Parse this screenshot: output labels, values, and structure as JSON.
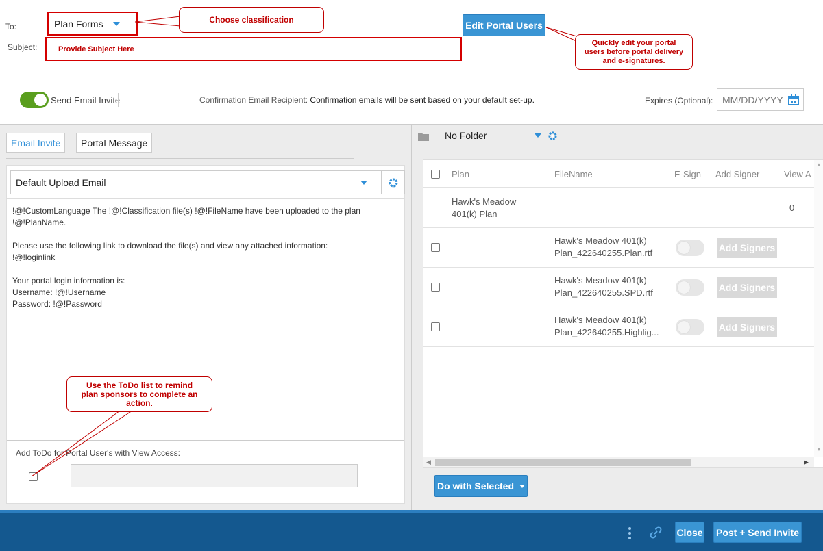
{
  "header": {
    "to_label": "To:",
    "classification_value": "Plan Forms",
    "subject_label": "Subject:",
    "subject_value": "Provide Subject Here",
    "edit_portal_users_label": "Edit Portal Users"
  },
  "callouts": {
    "classification": "Choose classification",
    "edit_users": "Quickly edit your portal users before portal delivery and e-signatures.",
    "todo": "Use the ToDo list to remind plan sponsors to complete an action."
  },
  "options_bar": {
    "send_email_invite_label": "Send Email Invite",
    "send_email_invite_on": true,
    "confirmation_label": "Confirmation Email Recipient:",
    "confirmation_text": "Confirmation emails will be sent based on your default set-up.",
    "expires_label": "Expires (Optional):",
    "expires_placeholder": "MM/DD/YYYY"
  },
  "left": {
    "tabs": [
      {
        "label": "Email Invite",
        "active": true
      },
      {
        "label": "Portal Message",
        "active": false
      }
    ],
    "template_select": "Default Upload Email",
    "email_body": "!@!CustomLanguage The !@!Classification file(s) !@!FileName have been uploaded to the plan\n!@!PlanName.\n\nPlease use the following link to download the file(s) and view any attached information:\n!@!loginlink\n\nYour portal login information is:\nUsername: !@!Username\nPassword: !@!Password",
    "todo_label": "Add ToDo for Portal User's with View Access:",
    "todo_value": ""
  },
  "right": {
    "folder": "No Folder",
    "columns": [
      "Plan",
      "FileName",
      "E-Sign",
      "Add Signer",
      "View A"
    ],
    "group_row": {
      "plan": "Hawk's Meadow 401(k) Plan",
      "view_count": "0"
    },
    "files": [
      {
        "filename": "Hawk's Meadow 401(k) Plan_422640255.Plan.rtf",
        "esign": false,
        "add_signers_label": "Add Signers"
      },
      {
        "filename": "Hawk's Meadow 401(k) Plan_422640255.SPD.rtf",
        "esign": false,
        "add_signers_label": "Add Signers"
      },
      {
        "filename": "Hawk's Meadow 401(k) Plan_422640255.Highlig...",
        "esign": false,
        "add_signers_label": "Add Signers"
      }
    ],
    "do_with_selected_label": "Do with Selected"
  },
  "footer": {
    "close_label": "Close",
    "post_send_label": "Post + Send Invite"
  },
  "colors": {
    "accent": "#3a95d4",
    "footer": "#14588f",
    "callout_red": "#c00000",
    "toggle_on": "#5a9e1e"
  }
}
